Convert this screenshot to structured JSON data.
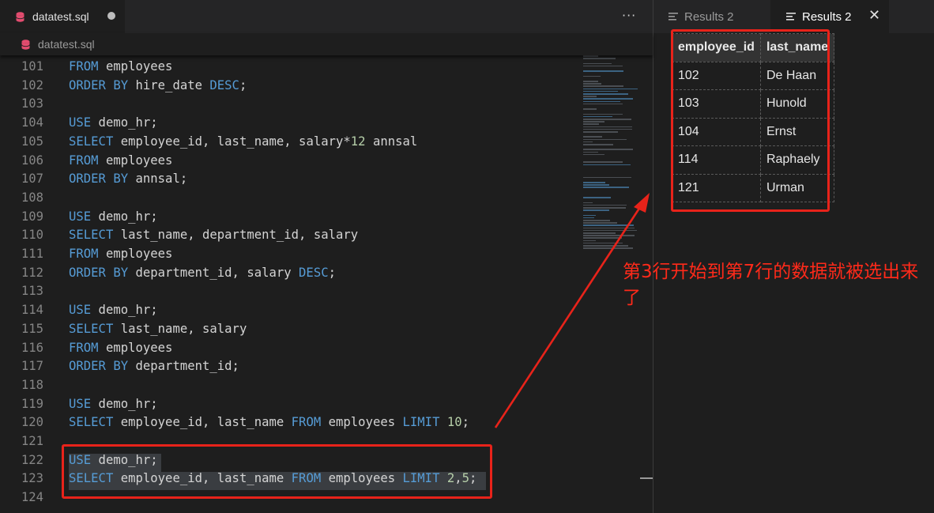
{
  "editor": {
    "tab_title": "datatest.sql",
    "breadcrumb_file": "datatest.sql",
    "more_label": "···",
    "lines": [
      {
        "n": "101",
        "tokens": [
          {
            "t": "FROM",
            "k": "kw"
          },
          {
            "t": " employees",
            "k": ""
          }
        ]
      },
      {
        "n": "102",
        "tokens": [
          {
            "t": "ORDER BY",
            "k": "kw"
          },
          {
            "t": " hire_date ",
            "k": ""
          },
          {
            "t": "DESC",
            "k": "kw"
          },
          {
            "t": ";",
            "k": ""
          }
        ]
      },
      {
        "n": "103",
        "tokens": []
      },
      {
        "n": "104",
        "tokens": [
          {
            "t": "USE",
            "k": "kw"
          },
          {
            "t": " demo_hr;",
            "k": ""
          }
        ]
      },
      {
        "n": "105",
        "tokens": [
          {
            "t": "SELECT",
            "k": "kw"
          },
          {
            "t": " employee_id, last_name, salary*",
            "k": ""
          },
          {
            "t": "12",
            "k": "num"
          },
          {
            "t": " annsal",
            "k": ""
          }
        ]
      },
      {
        "n": "106",
        "tokens": [
          {
            "t": "FROM",
            "k": "kw"
          },
          {
            "t": " employees",
            "k": ""
          }
        ]
      },
      {
        "n": "107",
        "tokens": [
          {
            "t": "ORDER BY",
            "k": "kw"
          },
          {
            "t": " annsal;",
            "k": ""
          }
        ]
      },
      {
        "n": "108",
        "tokens": []
      },
      {
        "n": "109",
        "tokens": [
          {
            "t": "USE",
            "k": "kw"
          },
          {
            "t": " demo_hr;",
            "k": ""
          }
        ]
      },
      {
        "n": "110",
        "tokens": [
          {
            "t": "SELECT",
            "k": "kw"
          },
          {
            "t": " last_name, department_id, salary",
            "k": ""
          }
        ]
      },
      {
        "n": "111",
        "tokens": [
          {
            "t": "FROM",
            "k": "kw"
          },
          {
            "t": " employees",
            "k": ""
          }
        ]
      },
      {
        "n": "112",
        "tokens": [
          {
            "t": "ORDER BY",
            "k": "kw"
          },
          {
            "t": " department_id, salary ",
            "k": ""
          },
          {
            "t": "DESC",
            "k": "kw"
          },
          {
            "t": ";",
            "k": ""
          }
        ]
      },
      {
        "n": "113",
        "tokens": []
      },
      {
        "n": "114",
        "tokens": [
          {
            "t": "USE",
            "k": "kw"
          },
          {
            "t": " demo_hr;",
            "k": ""
          }
        ]
      },
      {
        "n": "115",
        "tokens": [
          {
            "t": "SELECT",
            "k": "kw"
          },
          {
            "t": " last_name, salary",
            "k": ""
          }
        ]
      },
      {
        "n": "116",
        "tokens": [
          {
            "t": "FROM",
            "k": "kw"
          },
          {
            "t": " employees",
            "k": ""
          }
        ]
      },
      {
        "n": "117",
        "tokens": [
          {
            "t": "ORDER BY",
            "k": "kw"
          },
          {
            "t": " department_id;",
            "k": ""
          }
        ]
      },
      {
        "n": "118",
        "tokens": []
      },
      {
        "n": "119",
        "tokens": [
          {
            "t": "USE",
            "k": "kw"
          },
          {
            "t": " demo_hr;",
            "k": ""
          }
        ]
      },
      {
        "n": "120",
        "tokens": [
          {
            "t": "SELECT",
            "k": "kw"
          },
          {
            "t": " employee_id, last_name ",
            "k": ""
          },
          {
            "t": "FROM",
            "k": "kw"
          },
          {
            "t": " employees ",
            "k": ""
          },
          {
            "t": "LIMIT",
            "k": "kw"
          },
          {
            "t": " ",
            "k": ""
          },
          {
            "t": "10",
            "k": "num"
          },
          {
            "t": ";",
            "k": ""
          }
        ]
      },
      {
        "n": "121",
        "tokens": []
      },
      {
        "n": "122",
        "tokens": [
          {
            "t": "USE",
            "k": "kw"
          },
          {
            "t": " demo_hr;",
            "k": ""
          }
        ]
      },
      {
        "n": "123",
        "tokens": [
          {
            "t": "SELECT",
            "k": "kw"
          },
          {
            "t": " employee_id, last_name ",
            "k": ""
          },
          {
            "t": "FROM",
            "k": "kw"
          },
          {
            "t": " employees ",
            "k": ""
          },
          {
            "t": "LIMIT",
            "k": "kw"
          },
          {
            "t": " ",
            "k": ""
          },
          {
            "t": "2",
            "k": "num"
          },
          {
            "t": ",",
            "k": ""
          },
          {
            "t": "5",
            "k": "num"
          },
          {
            "t": ";",
            "k": ""
          }
        ]
      },
      {
        "n": "124",
        "tokens": []
      }
    ]
  },
  "results": {
    "tabs": [
      {
        "label": "Results 2",
        "active": false
      },
      {
        "label": "Results 2",
        "active": true
      }
    ],
    "close_label": "✕",
    "columns": [
      "employee_id",
      "last_name"
    ],
    "rows": [
      [
        "102",
        "De Haan"
      ],
      [
        "103",
        "Hunold"
      ],
      [
        "104",
        "Ernst"
      ],
      [
        "114",
        "Raphaely"
      ],
      [
        "121",
        "Urman"
      ]
    ]
  },
  "annotation": {
    "text": "第3行开始到第7行的数据就被选出来了",
    "color": "#e8231a"
  },
  "colors": {
    "keyword": "#569cd6",
    "number": "#b5cea8",
    "text": "#d4d4d4",
    "line_number": "#858585",
    "background": "#1e1e1e",
    "tab_bar": "#252526",
    "sql_icon": "#e34c6f"
  }
}
